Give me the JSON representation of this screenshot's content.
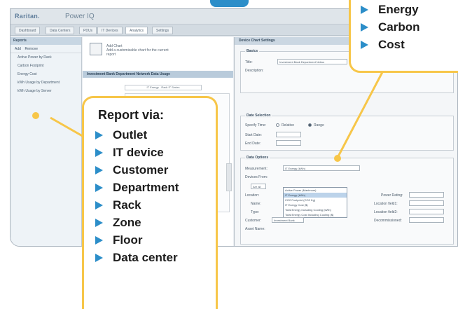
{
  "app": {
    "logo": "Raritan.",
    "name": "Power IQ"
  },
  "tabs": [
    {
      "label": "Dashboard"
    },
    {
      "label": "Data Centers"
    },
    {
      "label": "PDUs"
    },
    {
      "label": "IT Devices"
    },
    {
      "label": "Analytics",
      "active": true
    },
    {
      "label": "Settings"
    }
  ],
  "left_panel": {
    "title": "Reports",
    "add": "Add",
    "remove": "Remove",
    "items": [
      "Active Power by Rack",
      "Carbon Footprint",
      "Energy Cost",
      "kWh Usage by Department",
      "kWh Usage by Server"
    ]
  },
  "middle": {
    "add_chart": "Add Chart",
    "add_chart_desc": "Add a customizable chart for the current report",
    "bar_title": "Investment Bank Department Network Data Usage",
    "chart_title": "IT Energy - Rack IT Series"
  },
  "settings": {
    "title": "Device Chart Settings",
    "basics_legend": "Basics",
    "title_label": "Title:",
    "title_value": "Investment Bank Department Netwo",
    "description_label": "Description:",
    "date_legend": "Date Selection",
    "specify_label": "Specify Time:",
    "radio_relative": "Relative",
    "radio_range": "Range",
    "start_label": "Start Date:",
    "end_label": "End Date:",
    "data_legend": "Data Options",
    "measurement_label": "Measurement:",
    "measurement_value": "IT Energy (kWh)",
    "devices_label": "Devices From:",
    "dropdown_options": [
      "Active Power (Maximum)",
      "IT Energy (kWh)",
      "CO2 Footprint (CO2 Kg)",
      "IT Energy Cost ($)",
      "Total Energy Including Cooling (kWh)",
      "Total Energy Cost Including Cooling ($)"
    ],
    "add_all": "Are all",
    "location_label": "Location:",
    "name_label": "Name:",
    "type_label": "Type:",
    "customer_label": "Customer:",
    "customer_value": "Investment Bank",
    "asset_label": "Asset Name:",
    "power_rating_label": "Power Rating:",
    "location_field_label": "Location field1:",
    "location_field2_label": "Location field2:",
    "decommissioned_label": "Decommissioned:"
  },
  "callout_left": {
    "title": "Report via:",
    "items": [
      "Outlet",
      "IT device",
      "Customer",
      "Department",
      "Rack",
      "Zone",
      "Floor",
      "Data center"
    ]
  },
  "callout_right": {
    "items": [
      "Energy",
      "Carbon",
      "Cost"
    ]
  },
  "colors": {
    "callout_border": "#f7c649",
    "bullet": "#2c8ec9"
  },
  "icons": {
    "bullet": "triangle-arrow-right-icon",
    "chart": "chart-icon"
  }
}
